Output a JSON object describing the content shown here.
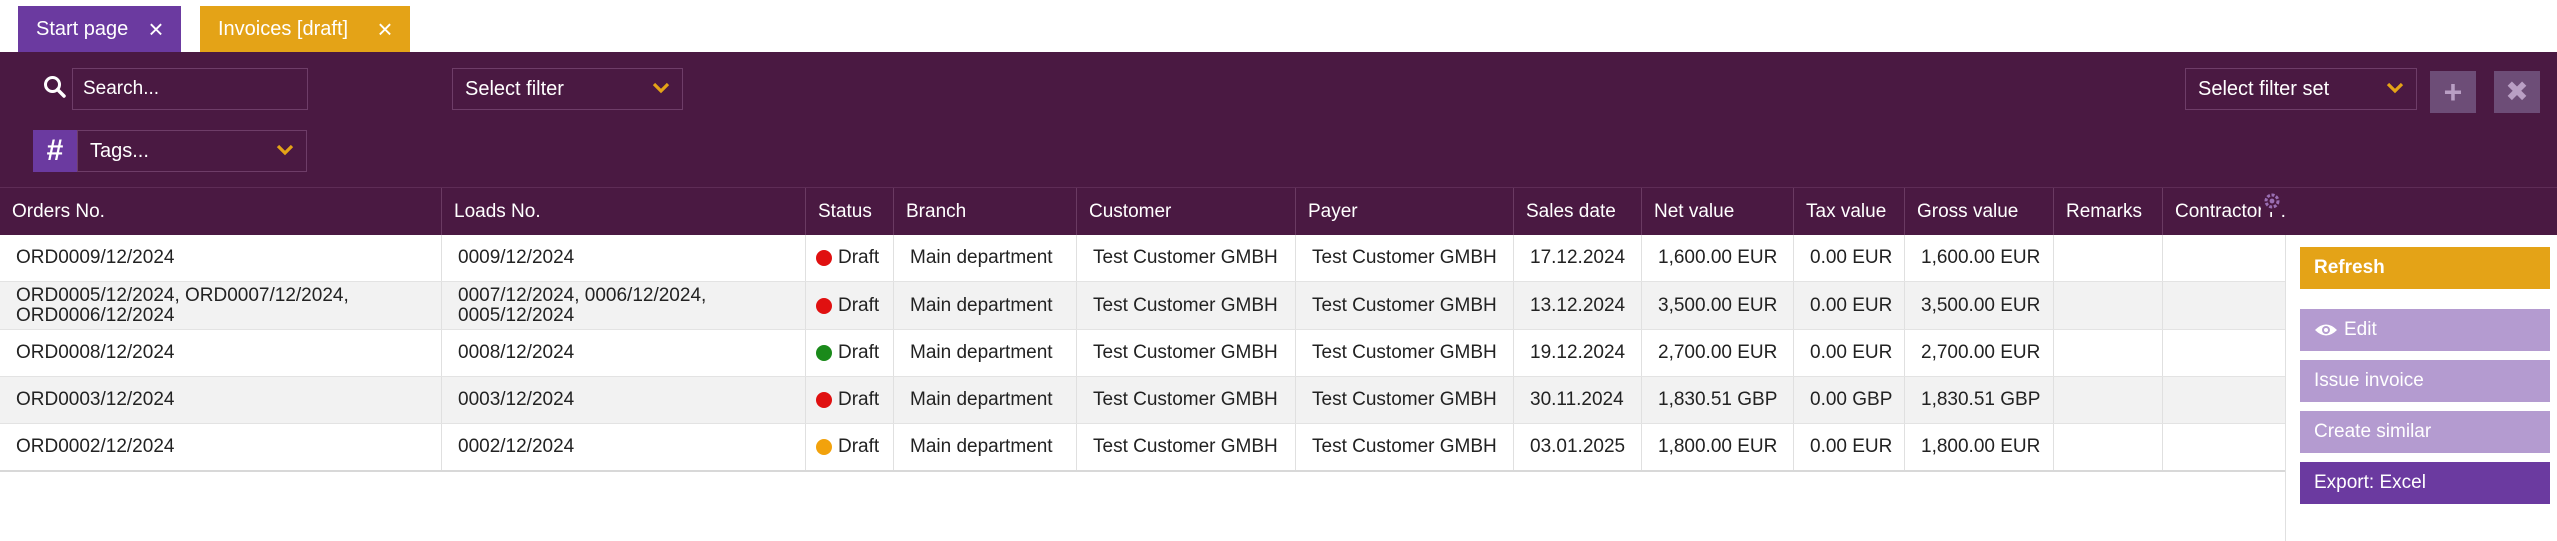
{
  "tabs": [
    {
      "label": "Start page",
      "close": "×"
    },
    {
      "label": "Invoices [draft]",
      "close": "×"
    }
  ],
  "filters": {
    "search_placeholder": "Search...",
    "filter_select": "Select filter",
    "filterset_select": "Select filter set",
    "tags_hash": "#",
    "tags_select": "Tags...",
    "add_symbol": "+",
    "clear_symbol": "✖"
  },
  "table": {
    "columns": [
      "Orders No.",
      "Loads No.",
      "Status",
      "Branch",
      "Customer",
      "Payer",
      "Sales date",
      "Net value",
      "Tax value",
      "Gross value",
      "Remarks",
      "Contractor r ..."
    ],
    "rows": [
      {
        "orders": "ORD0009/12/2024",
        "loads": "0009/12/2024",
        "status": "Draft",
        "status_color": "#e01010",
        "branch": "Main department",
        "customer": "Test Customer GMBH",
        "payer": "Test Customer GMBH",
        "sales_date": "17.12.2024",
        "net": "1,600.00 EUR",
        "tax": "0.00 EUR",
        "gross": "1,600.00 EUR",
        "remarks": "",
        "contractor": ""
      },
      {
        "orders": "ORD0005/12/2024, ORD0007/12/2024, ORD0006/12/2024",
        "loads": "0007/12/2024, 0006/12/2024, 0005/12/2024",
        "status": "Draft",
        "status_color": "#e01010",
        "branch": "Main department",
        "customer": "Test Customer GMBH",
        "payer": "Test Customer GMBH",
        "sales_date": "13.12.2024",
        "net": "3,500.00 EUR",
        "tax": "0.00 EUR",
        "gross": "3,500.00 EUR",
        "remarks": "",
        "contractor": ""
      },
      {
        "orders": "ORD0008/12/2024",
        "loads": "0008/12/2024",
        "status": "Draft",
        "status_color": "#1a8a1a",
        "branch": "Main department",
        "customer": "Test Customer GMBH",
        "payer": "Test Customer GMBH",
        "sales_date": "19.12.2024",
        "net": "2,700.00 EUR",
        "tax": "0.00 EUR",
        "gross": "2,700.00 EUR",
        "remarks": "",
        "contractor": ""
      },
      {
        "orders": "ORD0003/12/2024",
        "loads": "0003/12/2024",
        "status": "Draft",
        "status_color": "#e01010",
        "branch": "Main department",
        "customer": "Test Customer GMBH",
        "payer": "Test Customer GMBH",
        "sales_date": "30.11.2024",
        "net": "1,830.51 GBP",
        "tax": "0.00 GBP",
        "gross": "1,830.51 GBP",
        "remarks": "",
        "contractor": ""
      },
      {
        "orders": "ORD0002/12/2024",
        "loads": "0002/12/2024",
        "status": "Draft",
        "status_color": "#f2a20c",
        "branch": "Main department",
        "customer": "Test Customer GMBH",
        "payer": "Test Customer GMBH",
        "sales_date": "03.01.2025",
        "net": "1,800.00 EUR",
        "tax": "0.00 EUR",
        "gross": "1,800.00 EUR",
        "remarks": "",
        "contractor": ""
      }
    ]
  },
  "actions": {
    "refresh": "Refresh",
    "edit": "Edit",
    "issue": "Issue invoice",
    "similar": "Create similar",
    "export": "Export: Excel"
  },
  "colors": {
    "header_bg": "#4a1942",
    "accent_orange": "#e4a317",
    "accent_purple": "#6b3aa0",
    "disabled_purple": "#b49bd0"
  }
}
